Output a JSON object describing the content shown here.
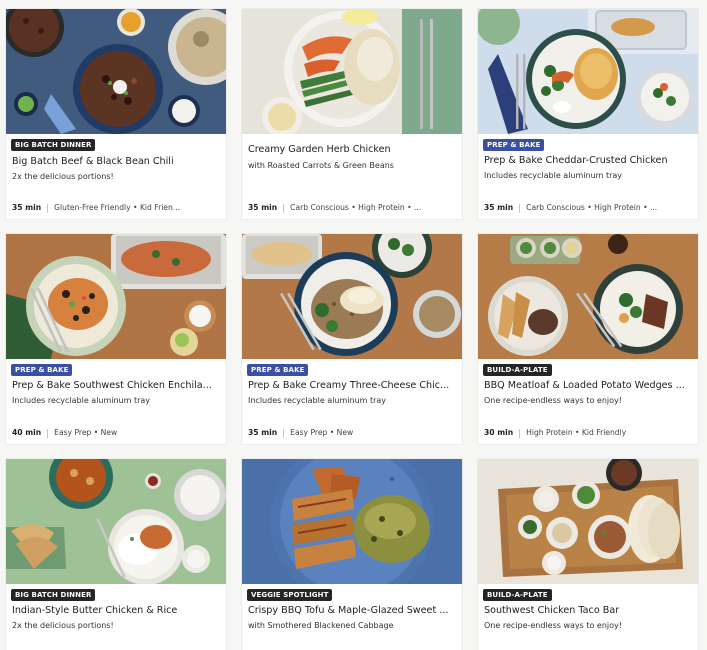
{
  "cards": [
    {
      "badge": "BIG BATCH DINNER",
      "title": "Big Batch Beef & Black Bean Chili",
      "subtitle": "2x the delicious portions!",
      "time": "35 min",
      "tags": "Gluten-Free Friendly • Kid Frien..."
    },
    {
      "badge": "",
      "title": "Creamy Garden Herb Chicken",
      "subtitle": "with Roasted Carrots & Green Beans",
      "time": "35 min",
      "tags": "Carb Conscious • High Protein • ..."
    },
    {
      "badge": "PREP & BAKE",
      "title": "Prep & Bake Cheddar-Crusted Chicken",
      "subtitle": "Includes recyclable aluminum tray",
      "time": "35 min",
      "tags": "Carb Conscious • High Protein • ..."
    },
    {
      "badge": "PREP & BAKE",
      "title": "Prep & Bake Southwest Chicken Enchila...",
      "subtitle": "Includes recyclable aluminum tray",
      "time": "40 min",
      "tags": "Easy Prep • New"
    },
    {
      "badge": "PREP & BAKE",
      "title": "Prep & Bake Creamy Three-Cheese Chic...",
      "subtitle": "Includes recyclable aluminum tray",
      "time": "35 min",
      "tags": "Easy Prep • New"
    },
    {
      "badge": "BUILD-A-PLATE",
      "title": "BBQ Meatloaf & Loaded Potato Wedges ...",
      "subtitle": "One recipe-endless ways to enjoy!",
      "time": "30 min",
      "tags": "High Protein • Kid Friendly"
    },
    {
      "badge": "BIG BATCH DINNER",
      "title": "Indian-Style Butter Chicken & Rice",
      "subtitle": "2x the delicious portions!",
      "time": "",
      "tags": ""
    },
    {
      "badge": "VEGGIE SPOTLIGHT",
      "title": "Crispy BBQ Tofu & Maple-Glazed Sweet ...",
      "subtitle": "with Smothered Blackened Cabbage",
      "time": "",
      "tags": ""
    },
    {
      "badge": "BUILD-A-PLATE",
      "title": "Southwest Chicken Taco Bar",
      "subtitle": "One recipe-endless ways to enjoy!",
      "time": "",
      "tags": ""
    }
  ],
  "colors": {
    "badge_dark": "#252525",
    "badge_blue": "#3b4fa3"
  }
}
